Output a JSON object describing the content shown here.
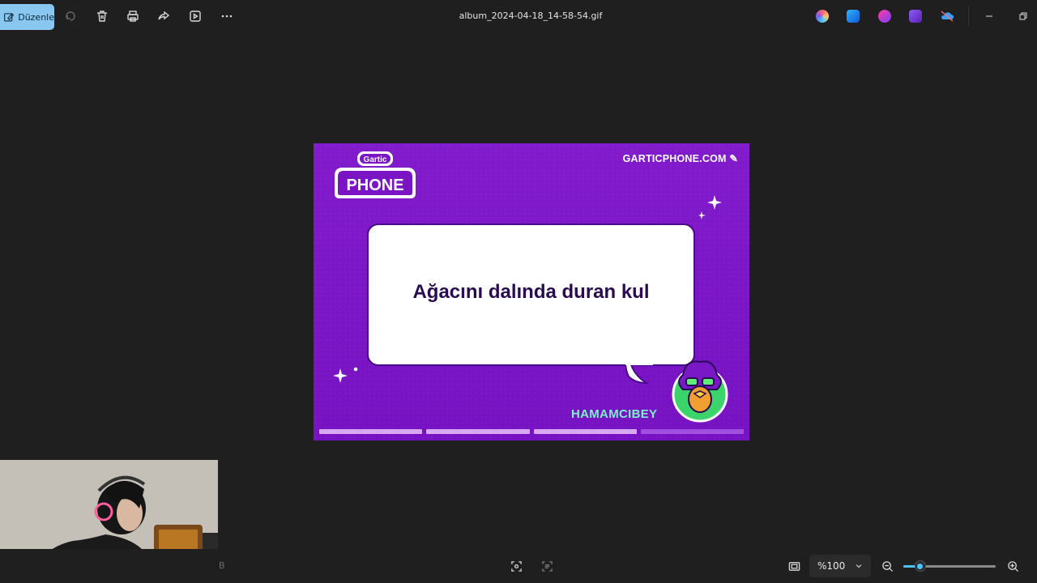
{
  "toolbar": {
    "edit_label": "Düzenle",
    "file_title": "album_2024-04-18_14-58-54.gif"
  },
  "toolbar_icons": [
    "rotate-icon",
    "delete-icon",
    "print-icon",
    "share-icon",
    "slideshow-icon",
    "more-icon"
  ],
  "taskbar_apps": [
    "copilot-app-icon",
    "designer-app-icon",
    "paint-app-icon",
    "clipchamp-app-icon",
    "onedrive-app-icon"
  ],
  "image": {
    "site": "GARTICPHONE.COM",
    "logo_top": "Gartic",
    "logo_bottom": "PHONE",
    "bubble_text": "Ağacını dalında duran kul",
    "player": "HAMAMCIBEY",
    "progress_segments": [
      1,
      1,
      1,
      0.5
    ]
  },
  "bottombar": {
    "zoom_value": "%100",
    "zoom_level": 0.18,
    "stray_char": "B"
  },
  "colors": {
    "accent": "#4cc2ff",
    "edit_button": "#8ac7f0",
    "card_purple": "#7b14c5",
    "player_name": "#7ef0d0"
  }
}
